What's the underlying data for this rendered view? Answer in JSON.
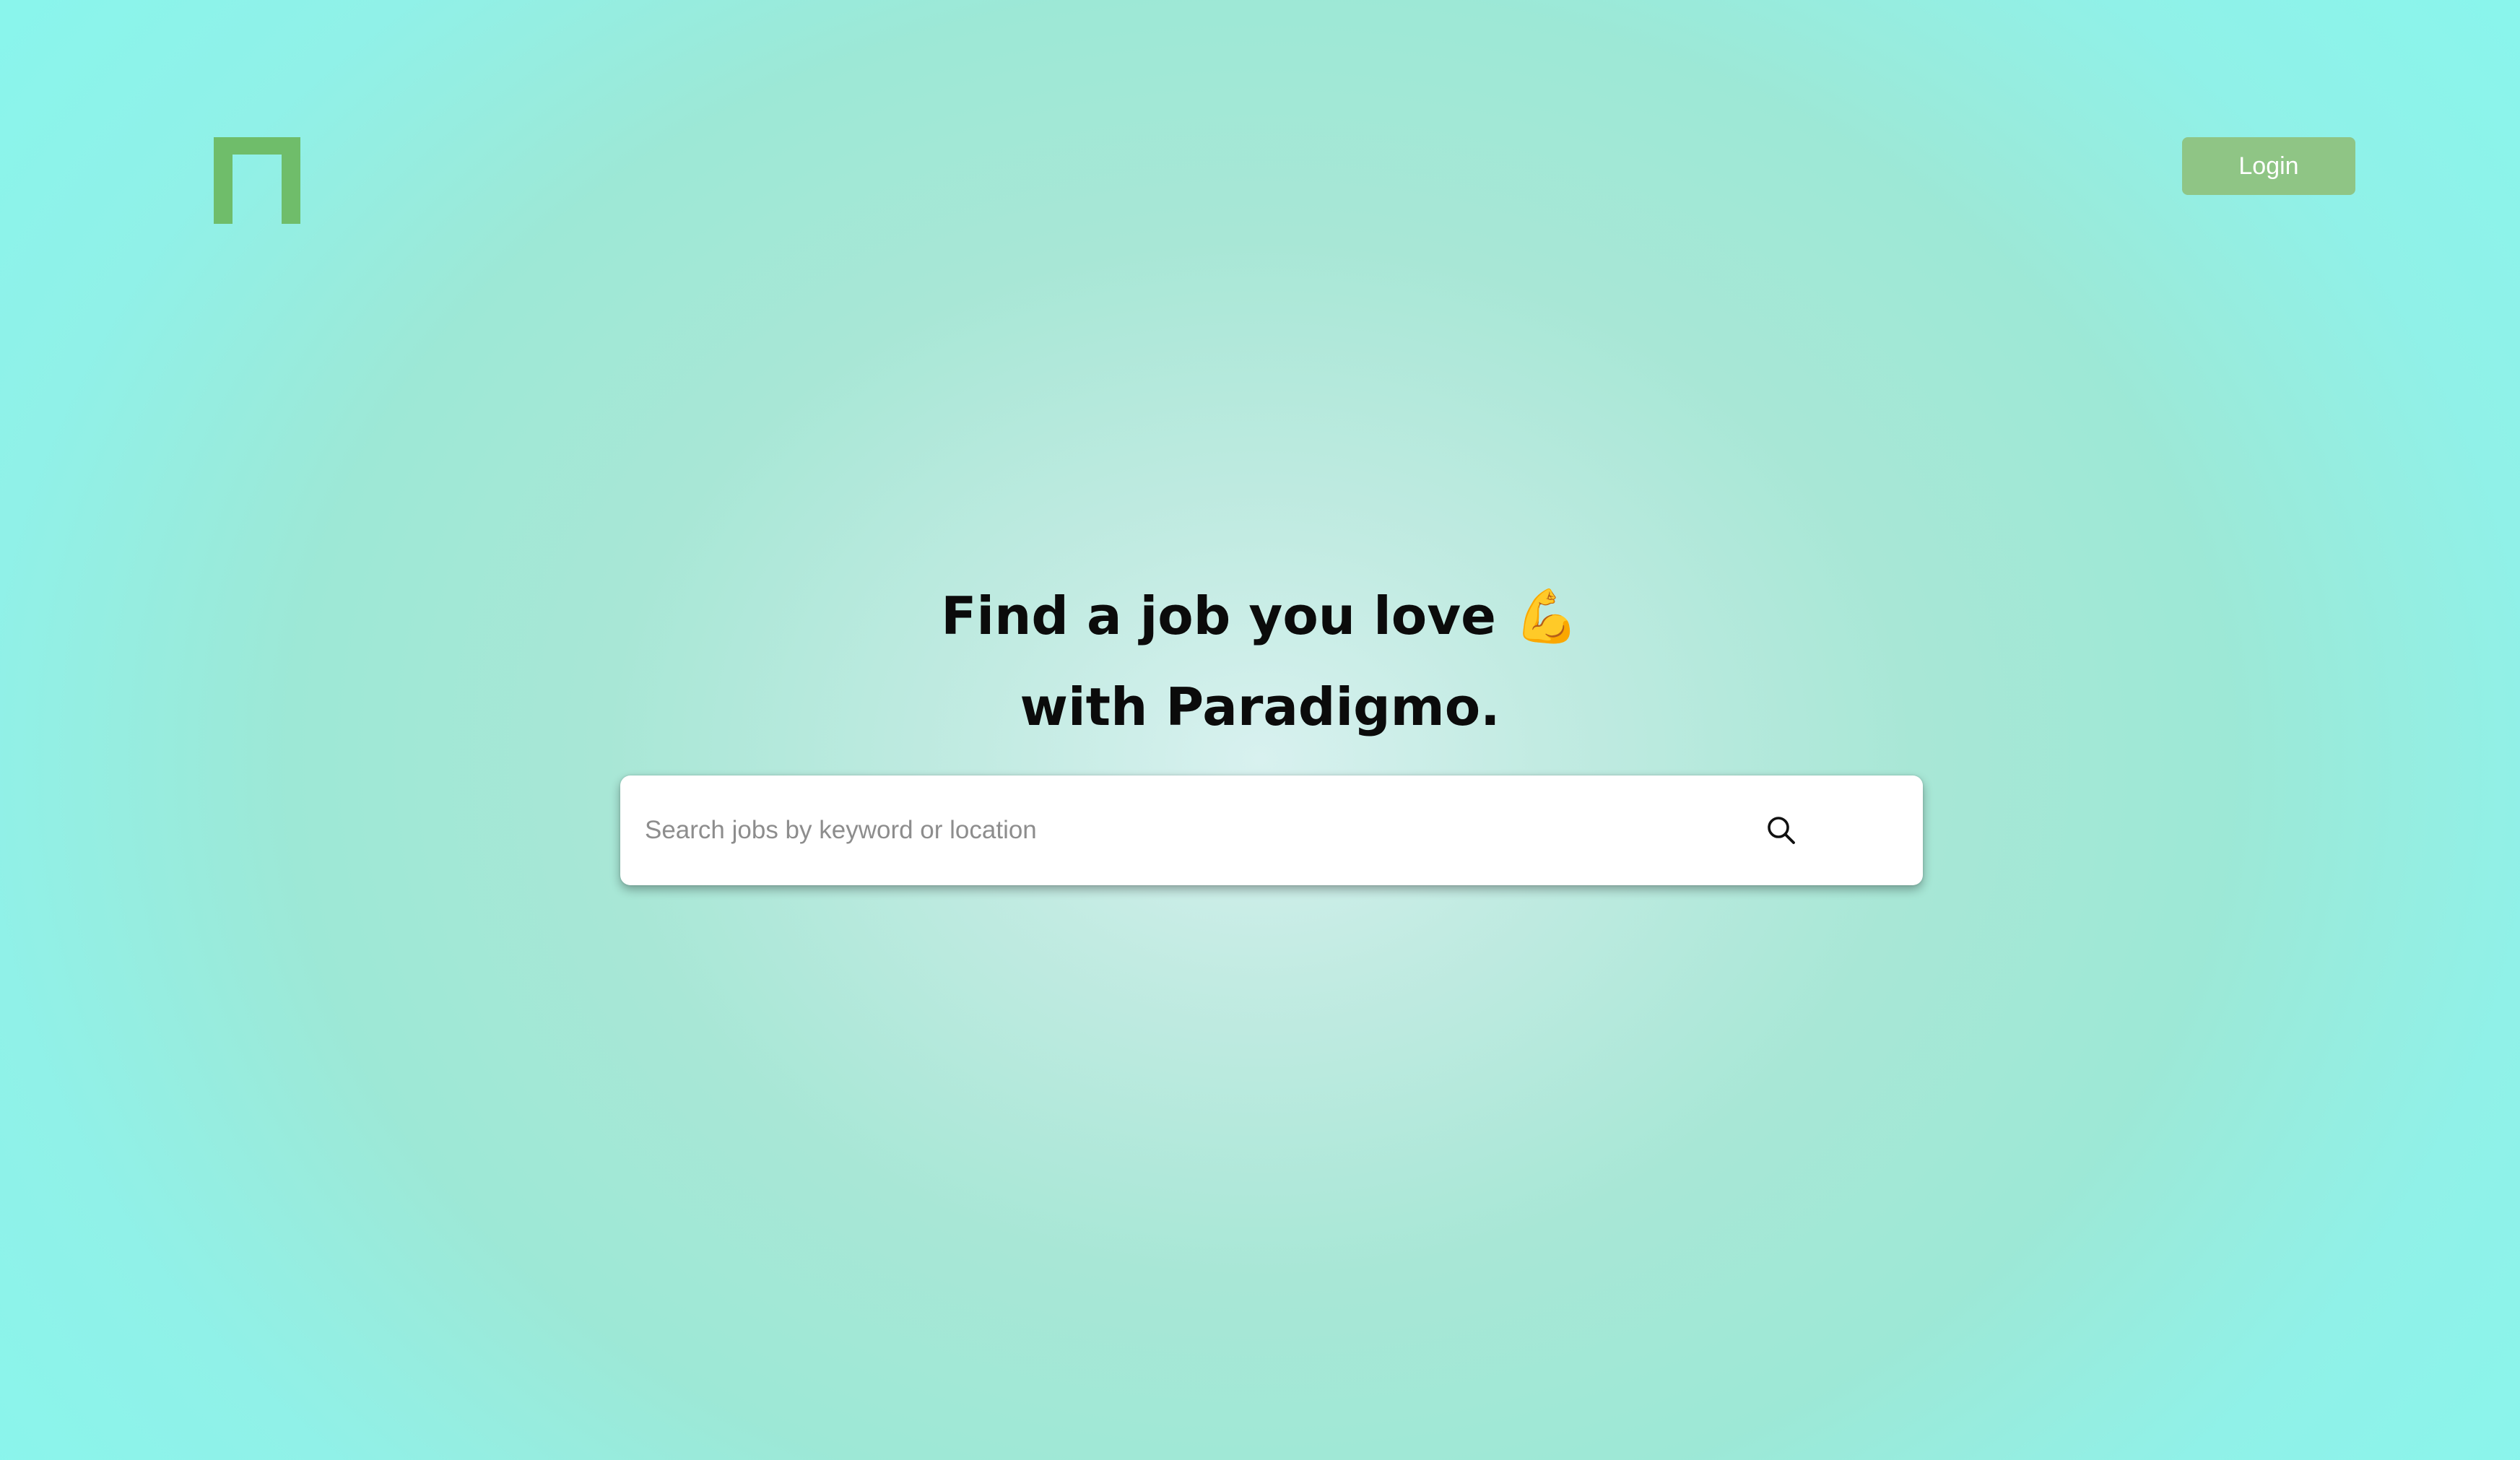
{
  "header": {
    "logo_icon": "paradigmo-logo-icon",
    "logo_color": "#6fbd6a",
    "login_label": "Login",
    "login_color": "#8fc585"
  },
  "hero": {
    "headline_line1": "Find a job you love 💪",
    "headline_line2": "with Paradigmo."
  },
  "search": {
    "placeholder": "Search jobs by keyword or location",
    "value": "",
    "icon": "search-icon"
  }
}
